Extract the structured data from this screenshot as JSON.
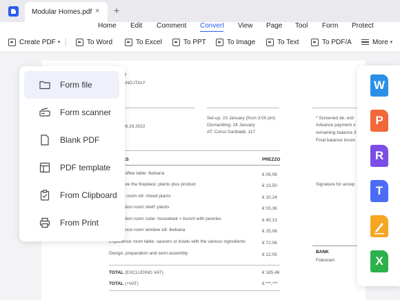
{
  "tab": {
    "title": "Modular Homes.pdf",
    "close": "×",
    "new_tab": "+"
  },
  "menu": [
    "Home",
    "Edit",
    "Comment",
    "Convert",
    "View",
    "Page",
    "Tool",
    "Form",
    "Protect"
  ],
  "menu_active": "Convert",
  "toolbar": {
    "create_pdf": "Create PDF",
    "to_word": "To Word",
    "to_excel": "To Excel",
    "to_ppt": "To PPT",
    "to_image": "To Image",
    "to_text": "To Text",
    "to_pdfa": "To PDF/A",
    "more": "More"
  },
  "create_menu": {
    "items": [
      {
        "label": "Form file",
        "icon": "folder-icon"
      },
      {
        "label": "Form scanner",
        "icon": "scanner-icon"
      },
      {
        "label": "Blank PDF",
        "icon": "blank-page-icon"
      },
      {
        "label": "PDF template",
        "icon": "template-icon"
      },
      {
        "label": "From Clipboard",
        "icon": "clipboard-icon"
      },
      {
        "label": "From Print",
        "icon": "printer-icon"
      }
    ]
  },
  "convert_formats": [
    {
      "letter": "W",
      "color": "#2b8fe8",
      "icon": "word-format-icon"
    },
    {
      "letter": "P",
      "color": "#f2683a",
      "icon": "ppt-format-icon"
    },
    {
      "letter": "R",
      "color": "#7b4ee6",
      "icon": "rtf-format-icon"
    },
    {
      "letter": "T",
      "color": "#4a6cf7",
      "icon": "text-format-icon"
    },
    {
      "letter": "",
      "color": "#f5a623",
      "icon": "pages-format-icon"
    },
    {
      "letter": "X",
      "color": "#2bb24c",
      "icon": "excel-format-icon"
    }
  ],
  "document": {
    "header_o": "O",
    "header_city": "ANO,ITALY",
    "date": "06.19.2022",
    "setup": "Set-up: 23 January (from 3:00 pm)",
    "dismantling": "Dismantling: 24 January",
    "location": "AT: Corso Garibaldi, 117",
    "notes": [
      "* Screened de, esti",
      "Advance payment o",
      "remaining balance 3",
      "Final balance invoic"
    ],
    "col_items": "ES",
    "col_price": "PREZZO",
    "rows": [
      {
        "desc": "coffee table: Ikebana",
        "price": "€ 09,06"
      },
      {
        "desc": "ove the fireplace: plants plus product",
        "price": "€ 13,50"
      },
      {
        "desc": "g room sill: mixed plants",
        "price": "€ 10,24"
      },
      {
        "desc": "ation room shelf: plants",
        "price": "€ 03,36"
      },
      {
        "desc": "ation room cube: houseleek + bunch with peonies",
        "price": "€ 40,13"
      },
      {
        "desc": "ance room window sill: Ikebana",
        "price": "€ 25,06"
      },
      {
        "desc": "Experience room table: saucers or bowls with the various ingredients",
        "price": "€ 72,06"
      },
      {
        "desc": "Design, preparation and semi-assembly",
        "price": "€ 12,05"
      }
    ],
    "signature": "Signature for accep",
    "bank_label": "BANK",
    "bank_name": "Fideuram",
    "total_excl_label": "TOTAL",
    "total_excl_note": "(EXCLUDING VAT)",
    "total_excl_value": "€ 185,46",
    "total_vat_label": "TOTAL",
    "total_vat_note": "(+VAT)",
    "total_vat_value": "€ ***,***"
  }
}
